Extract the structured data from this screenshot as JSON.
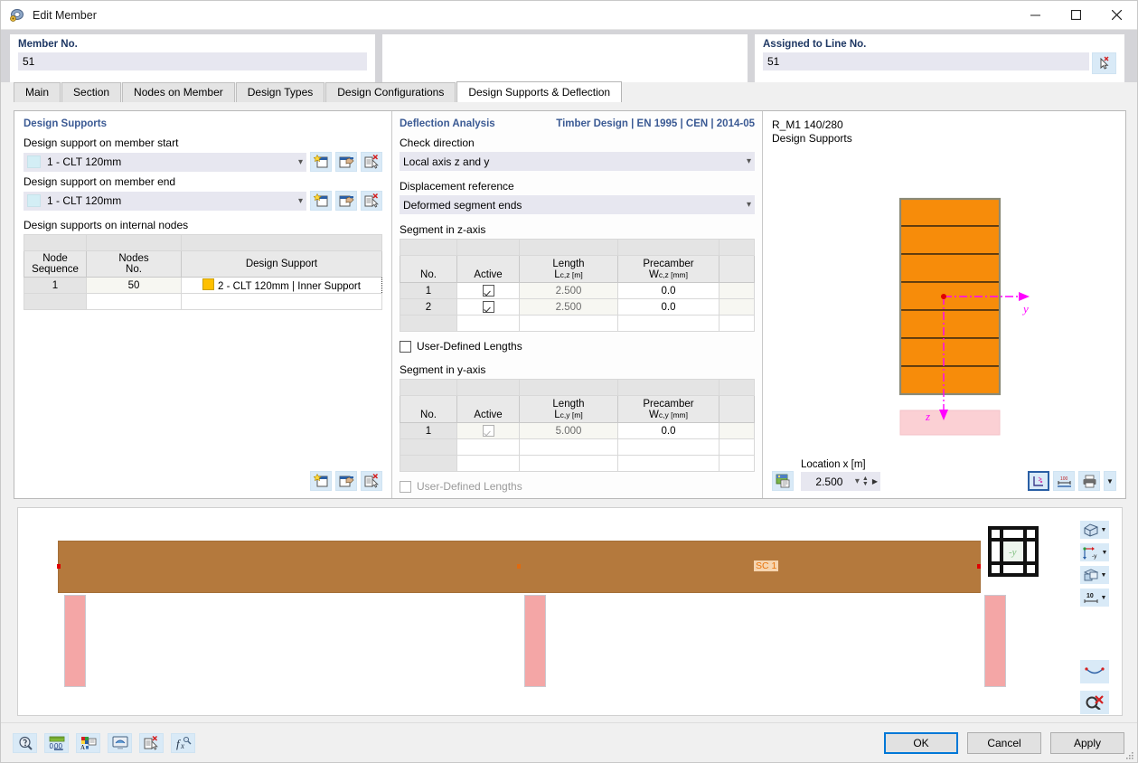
{
  "window": {
    "title": "Edit Member",
    "icon": "member-icon",
    "minimize": "─",
    "maximize": "□",
    "close": "✕"
  },
  "header": {
    "member_no_label": "Member No.",
    "member_no_value": "51",
    "assigned_line_label": "Assigned to Line No.",
    "assigned_line_value": "51",
    "pick_icon": "select-pointer-icon"
  },
  "tabs": [
    {
      "label": "Main",
      "active": false
    },
    {
      "label": "Section",
      "active": false
    },
    {
      "label": "Nodes on Member",
      "active": false
    },
    {
      "label": "Design Types",
      "active": false
    },
    {
      "label": "Design Configurations",
      "active": false
    },
    {
      "label": "Design Supports & Deflection",
      "active": true
    }
  ],
  "design_supports": {
    "panel_title": "Design Supports",
    "start_label": "Design support on member start",
    "start_value": "1 - CLT   120mm",
    "end_label": "Design support on member end",
    "end_value": "1 - CLT   120mm",
    "internal_label": "Design supports on internal nodes",
    "row_buttons": [
      "new-icon",
      "edit-icon",
      "delete-icon"
    ],
    "table": {
      "headers": [
        "Node\nSequence",
        "Nodes\nNo.",
        "Design Support"
      ],
      "header_node_seq_l1": "Node",
      "header_node_seq_l2": "Sequence",
      "header_nodes_l1": "Nodes",
      "header_nodes_l2": "No.",
      "header_design_support": "Design Support",
      "rows": [
        {
          "seq": "1",
          "node": "50",
          "support": "2 - CLT   120mm | Inner Support",
          "color": "#ffc000"
        }
      ]
    }
  },
  "deflection": {
    "panel_title": "Deflection Analysis",
    "standard": "Timber Design | EN 1995 | CEN | 2014-05",
    "check_direction_label": "Check direction",
    "check_direction_value": "Local axis z and y",
    "displacement_ref_label": "Displacement reference",
    "displacement_ref_value": "Deformed segment ends",
    "segment_z": {
      "title": "Segment in z-axis",
      "headers": {
        "no": "No.",
        "active": "Active",
        "length_l1": "Length",
        "length_l2": "L",
        "length_sub": "c,z",
        "length_unit": " [m]",
        "precamber_l1": "Precamber",
        "precamber_l2": "W",
        "precamber_sub": "c,z",
        "precamber_unit": " [mm]"
      },
      "rows": [
        {
          "no": "1",
          "active": true,
          "length": "2.500",
          "precamber": "0.0"
        },
        {
          "no": "2",
          "active": true,
          "length": "2.500",
          "precamber": "0.0"
        }
      ],
      "user_defined_label": "User-Defined Lengths",
      "user_defined_checked": false,
      "user_defined_disabled": false
    },
    "segment_y": {
      "title": "Segment in y-axis",
      "headers": {
        "no": "No.",
        "active": "Active",
        "length_l1": "Length",
        "length_l2": "L",
        "length_sub": "c,y",
        "length_unit": " [m]",
        "precamber_l1": "Precamber",
        "precamber_l2": "W",
        "precamber_sub": "c,y",
        "precamber_unit": " [mm]"
      },
      "rows": [
        {
          "no": "1",
          "active": true,
          "length": "5.000",
          "precamber": "0.0"
        }
      ],
      "user_defined_label": "User-Defined Lengths",
      "user_defined_checked": false,
      "user_defined_disabled": true
    }
  },
  "section_view": {
    "caption_line1": "R_M1 140/280",
    "caption_line2": "Design Supports",
    "axis_y_label": "y",
    "axis_z_label": "z",
    "layer_count": 7,
    "layer_color": "#f78c0a",
    "support_color": "#fbd0d4",
    "axis_color": "#ff00ff",
    "location_label": "Location x [m]",
    "location_value": "2.500",
    "tool_icons": [
      "image-export-icon",
      "axes-display-icon",
      "dimensions-icon",
      "print-icon",
      "print-dropdown-icon"
    ]
  },
  "viewport": {
    "sc_label": "SC 1",
    "beam_color": "#b4793d",
    "column_color": "#f4a6a6",
    "navcube_label": "-y",
    "tools": [
      {
        "name": "render-mode-icon",
        "dropdown": true
      },
      {
        "name": "view-direction-icon",
        "dropdown": true,
        "label": "-y"
      },
      {
        "name": "projection-icon",
        "dropdown": true
      },
      {
        "name": "scale-icon",
        "dropdown": true,
        "label": "10"
      },
      {
        "name": "deformation-icon",
        "dropdown": false
      },
      {
        "name": "clear-selection-icon",
        "dropdown": false
      }
    ]
  },
  "statusbar": {
    "icons": [
      "info-icon",
      "units-icon",
      "display-properties-icon",
      "view-settings-icon",
      "delete-selection-icon",
      "formula-icon"
    ],
    "buttons": {
      "ok": "OK",
      "cancel": "Cancel",
      "apply": "Apply"
    }
  }
}
